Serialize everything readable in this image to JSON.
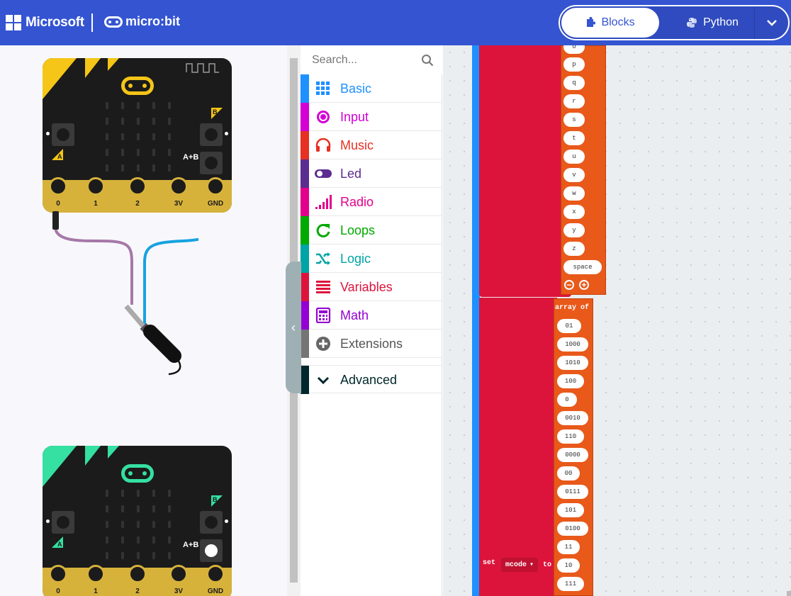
{
  "header": {
    "brand": "Microsoft",
    "product": "micro:bit",
    "tabs": [
      {
        "label": "Blocks",
        "icon": "puzzle-icon",
        "active": true
      },
      {
        "label": "Python",
        "icon": "python-icon",
        "active": false
      }
    ]
  },
  "simulator": {
    "boards": [
      {
        "accent": "#f5c518",
        "pins": [
          "0",
          "1",
          "2",
          "3V",
          "GND"
        ],
        "labels": {
          "a": "A",
          "b": "B",
          "ab": "A+B"
        }
      },
      {
        "accent": "#35e0a2",
        "pins": [
          "0",
          "1",
          "2",
          "3V",
          "GND"
        ],
        "labels": {
          "a": "A",
          "b": "B",
          "ab": "A+B"
        }
      }
    ]
  },
  "toolbox": {
    "search_placeholder": "Search...",
    "categories": [
      {
        "label": "Basic",
        "color": "#1e90ff"
      },
      {
        "label": "Input",
        "color": "#d400d4"
      },
      {
        "label": "Music",
        "color": "#e63022"
      },
      {
        "label": "Led",
        "color": "#5c2d91"
      },
      {
        "label": "Radio",
        "color": "#e3008c"
      },
      {
        "label": "Loops",
        "color": "#00aa00"
      },
      {
        "label": "Logic",
        "color": "#00a4a6"
      },
      {
        "label": "Variables",
        "color": "#dc143c"
      },
      {
        "label": "Math",
        "color": "#9400d3"
      },
      {
        "label": "Extensions",
        "color": "#757575"
      },
      {
        "label": "Advanced",
        "color": "#00272b"
      }
    ]
  },
  "workspace": {
    "letters": [
      "o",
      "p",
      "q",
      "r",
      "s",
      "t",
      "u",
      "v",
      "w",
      "x",
      "y",
      "z",
      "space"
    ],
    "array_label": "array of",
    "codes": [
      "01",
      "1000",
      "1010",
      "100",
      "0",
      "0010",
      "110",
      "0000",
      "00",
      "0111",
      "101",
      "0100",
      "11",
      "10",
      "111"
    ],
    "set_label": "set",
    "variable": "mcode",
    "to_label": "to"
  }
}
